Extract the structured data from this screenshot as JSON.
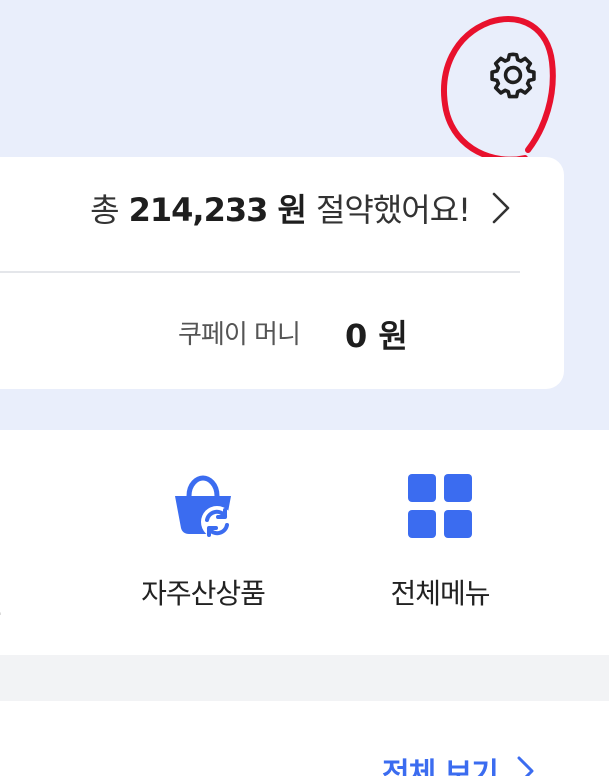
{
  "savings": {
    "prefix": "총",
    "amount": "214,233 원",
    "suffix": "절약했어요!"
  },
  "money": {
    "label": "쿠페이 머니",
    "value": "0 원"
  },
  "menu": {
    "items": [
      {
        "label": "자주산상품",
        "icon": "shopping-bag-refresh-icon"
      },
      {
        "label": "전체메뉴",
        "icon": "grid-icon"
      }
    ]
  },
  "bottom": {
    "view_all": "전체 보기"
  },
  "colors": {
    "accent": "#3b6cf0",
    "top_bg": "#e9eefb",
    "annotation": "#e8112d"
  }
}
